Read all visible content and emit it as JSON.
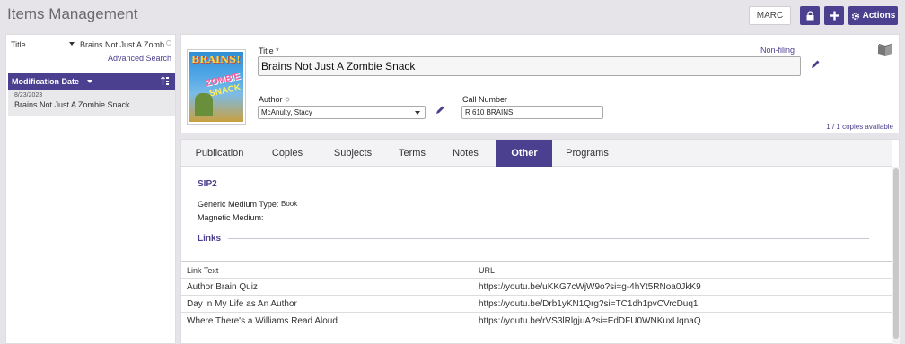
{
  "app": {
    "title": "Items Management",
    "toolbar": {
      "marc_label": "MARC",
      "actions_label": "Actions"
    }
  },
  "sidebar": {
    "search_field": "Title",
    "search_value": "Brains Not Just A Zomb",
    "advanced_search_label": "Advanced Search",
    "sort_label": "Modification Date",
    "items": [
      {
        "date": "8/23/2023",
        "title": "Brains Not Just A Zombie Snack"
      }
    ]
  },
  "item": {
    "title_label": "Title *",
    "non_filing_label": "Non-filing",
    "title_value": "Brains Not Just A Zombie Snack",
    "author_label": "Author",
    "author_value": "McAnulty, Stacy",
    "call_number_label": "Call Number",
    "call_number_value": "R 610 BRAINS",
    "copies_available": "1 / 1 copies available",
    "cover_text": [
      "BRAINS!",
      "ZOMBIE",
      "SNACK"
    ]
  },
  "tabs": [
    {
      "label": "Publication",
      "active": false
    },
    {
      "label": "Copies",
      "active": false
    },
    {
      "label": "Subjects",
      "active": false
    },
    {
      "label": "Terms",
      "active": false
    },
    {
      "label": "Notes",
      "active": false
    },
    {
      "label": "Other",
      "active": true
    },
    {
      "label": "Programs",
      "active": false
    }
  ],
  "other": {
    "sip2_heading": "SIP2",
    "generic_medium_label": "Generic Medium Type:",
    "generic_medium_value": "Book",
    "magnetic_medium_label": "Magnetic Medium:",
    "links_heading": "Links",
    "links_columns": [
      "Link Text",
      "URL"
    ],
    "links": [
      {
        "text": "Author Brain Quiz",
        "url": "https://youtu.be/uKKG7cWjW9o?si=g-4hYt5RNoa0JkK9"
      },
      {
        "text": "Day in My Life as An Author",
        "url": "https://youtu.be/Drb1yKN1Qrg?si=TC1dh1pvCVrcDuq1"
      },
      {
        "text": "Where There's a Williams Read Aloud",
        "url": "https://youtu.be/rVS3lRlgjuA?si=EdDFU0WNKuxUqnaQ"
      }
    ]
  },
  "colors": {
    "accent": "#4b3f8f",
    "background": "#e6e4e8"
  }
}
